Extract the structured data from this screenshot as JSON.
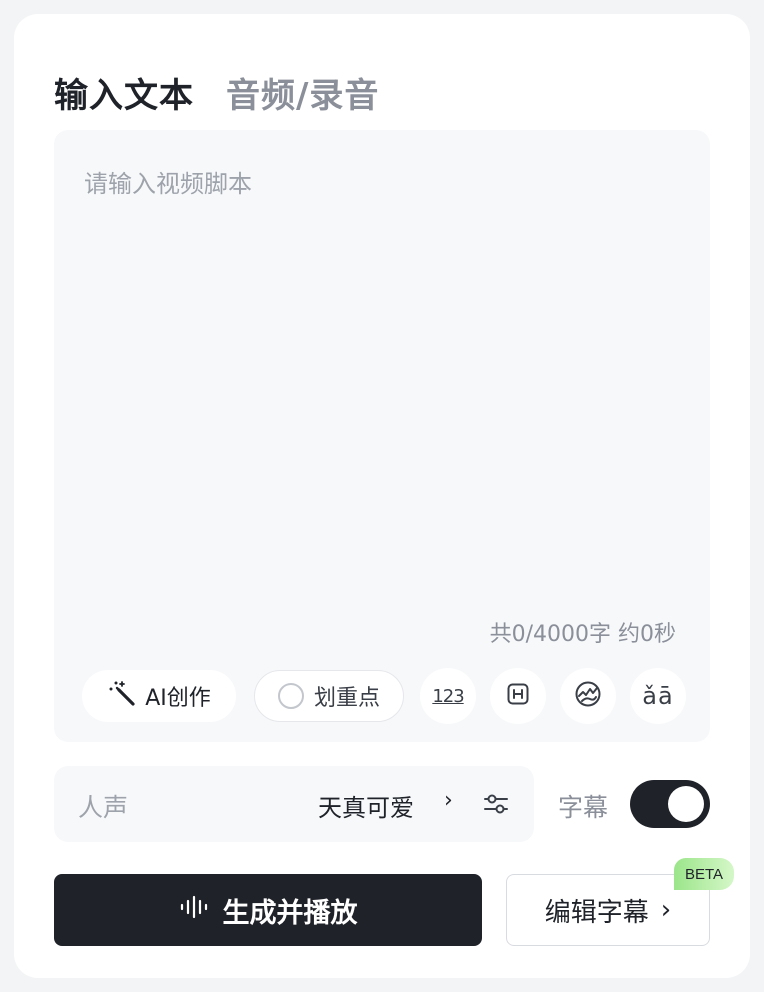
{
  "tabs": [
    {
      "label": "输入文本",
      "active": true
    },
    {
      "label": "音频/录音",
      "active": false
    }
  ],
  "editor": {
    "placeholder": "请输入视频脚本",
    "value": "",
    "counter": "共0/4000字 约0秒"
  },
  "toolbar": {
    "ai_label": "AI创作",
    "mark_label": "划重点",
    "number_icon_text": "123",
    "tone_icon_text": "ǎā",
    "icons": [
      "magic-wand-icon",
      "radio-circle-icon",
      "number-read-icon",
      "pause-insert-icon",
      "sound-effect-icon",
      "pronunciation-icon"
    ]
  },
  "voice": {
    "label": "人声",
    "value": "天真可爱",
    "chevron": "›"
  },
  "subtitle": {
    "label": "字幕",
    "enabled": true
  },
  "actions": {
    "generate_label": "生成并播放",
    "edit_subtitle_label": "编辑字幕",
    "beta_badge": "BETA",
    "edit_chevron": "›"
  },
  "colors": {
    "primary_dark": "#1f2329",
    "muted_text": "#8a8f99",
    "panel_bg": "#f7f8fa",
    "beta_green": "#9be58a"
  }
}
